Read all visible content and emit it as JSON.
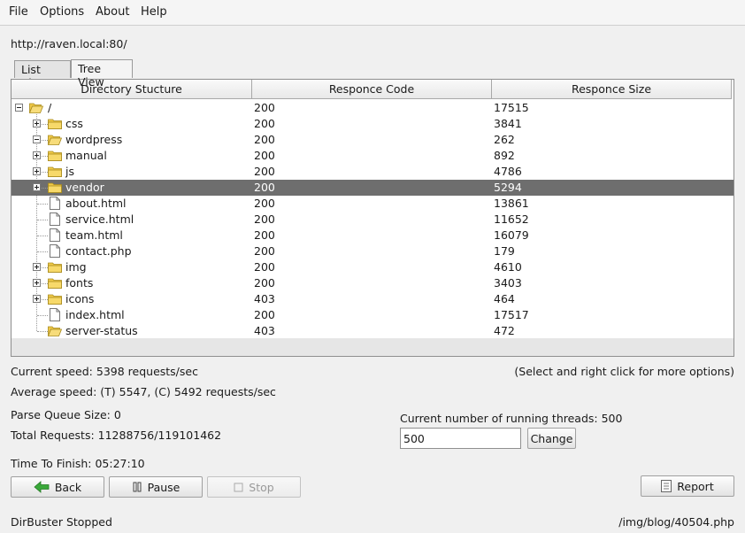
{
  "menu": [
    "File",
    "Options",
    "About",
    "Help"
  ],
  "target_url": "http://raven.local:80/",
  "tabs": [
    {
      "label": "List View",
      "active": false
    },
    {
      "label": "Tree View",
      "active": true
    }
  ],
  "table": {
    "columns": [
      "Directory Stucture",
      "Responce Code",
      "Responce Size"
    ],
    "rows": [
      {
        "name": "/",
        "code": "200",
        "size": "17515",
        "type": "folder-open",
        "expander": "minus",
        "selected": false
      },
      {
        "name": "css",
        "code": "200",
        "size": "3841",
        "type": "folder",
        "expander": "plus",
        "selected": false
      },
      {
        "name": "wordpress",
        "code": "200",
        "size": "262",
        "type": "folder-open",
        "expander": "minus",
        "selected": false
      },
      {
        "name": "manual",
        "code": "200",
        "size": "892",
        "type": "folder",
        "expander": "plus",
        "selected": false
      },
      {
        "name": "js",
        "code": "200",
        "size": "4786",
        "type": "folder",
        "expander": "plus",
        "selected": false
      },
      {
        "name": "vendor",
        "code": "200",
        "size": "5294",
        "type": "folder",
        "expander": "plus",
        "selected": true
      },
      {
        "name": "about.html",
        "code": "200",
        "size": "13861",
        "type": "file",
        "expander": "none",
        "selected": false
      },
      {
        "name": "service.html",
        "code": "200",
        "size": "11652",
        "type": "file",
        "expander": "none",
        "selected": false
      },
      {
        "name": "team.html",
        "code": "200",
        "size": "16079",
        "type": "file",
        "expander": "none",
        "selected": false
      },
      {
        "name": "contact.php",
        "code": "200",
        "size": "179",
        "type": "file",
        "expander": "none",
        "selected": false
      },
      {
        "name": "img",
        "code": "200",
        "size": "4610",
        "type": "folder",
        "expander": "plus",
        "selected": false
      },
      {
        "name": "fonts",
        "code": "200",
        "size": "3403",
        "type": "folder",
        "expander": "plus",
        "selected": false
      },
      {
        "name": "icons",
        "code": "403",
        "size": "464",
        "type": "folder",
        "expander": "plus",
        "selected": false
      },
      {
        "name": "index.html",
        "code": "200",
        "size": "17517",
        "type": "file",
        "expander": "none",
        "selected": false
      },
      {
        "name": "server-status",
        "code": "403",
        "size": "472",
        "type": "folder-open",
        "expander": "none",
        "selected": false
      }
    ]
  },
  "stats": {
    "current_speed": "Current speed: 5398 requests/sec",
    "hint": "(Select and right click for more options)",
    "average_speed": "Average speed: (T) 5547, (C) 5492 requests/sec",
    "parse_queue": "Parse Queue Size: 0",
    "total_requests": "Total Requests: 11288756/119101462",
    "time_to_finish": "Time To Finish: 05:27:10",
    "threads_label": "Current number of running threads: 500"
  },
  "threads_input": {
    "value": "500"
  },
  "buttons": {
    "change": "Change",
    "back": "Back",
    "pause": "Pause",
    "stop": "Stop",
    "report": "Report"
  },
  "status": {
    "left": "DirBuster Stopped",
    "right": "/img/blog/40504.php"
  },
  "colors": {
    "selected_row": "#6e6e6e",
    "folder": "#f0c948",
    "back_arrow": "#3aa83a"
  }
}
